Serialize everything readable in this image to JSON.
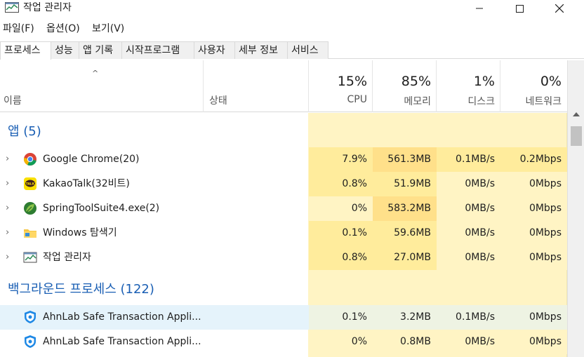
{
  "window": {
    "title": "작업 관리자",
    "minimize_glyph": "—",
    "maximize_glyph": "☐",
    "close_glyph": "✕"
  },
  "menu": [
    "파일(F)",
    "옵션(O)",
    "보기(V)"
  ],
  "tabs": [
    "프로세스",
    "성능",
    "앱 기록",
    "시작프로그램",
    "사용자",
    "세부 정보",
    "서비스"
  ],
  "active_tab": "프로세스",
  "header": {
    "sort_indicator": "^",
    "name": "이름",
    "status": "상태",
    "cpu": {
      "percent": "15%",
      "label": "CPU"
    },
    "memory": {
      "percent": "85%",
      "label": "메모리"
    },
    "disk": {
      "percent": "1%",
      "label": "디스크"
    },
    "network": {
      "percent": "0%",
      "label": "네트워크"
    }
  },
  "groups": {
    "apps": {
      "title": "앱 (5)",
      "rows": [
        {
          "name": "Google Chrome(20)",
          "icon": "chrome-icon",
          "cpu": "7.9%",
          "memory": "561.3MB",
          "disk": "0.1MB/s",
          "network": "0.2Mbps"
        },
        {
          "name": "KakaoTalk(32비트)",
          "icon": "kakaotalk-icon",
          "icon_text": "TALK",
          "cpu": "0.8%",
          "memory": "51.9MB",
          "disk": "0MB/s",
          "network": "0Mbps"
        },
        {
          "name": "SpringToolSuite4.exe(2)",
          "icon": "spring-icon",
          "cpu": "0%",
          "memory": "583.2MB",
          "disk": "0MB/s",
          "network": "0Mbps"
        },
        {
          "name": "Windows 탐색기",
          "icon": "folder-icon",
          "cpu": "0.1%",
          "memory": "59.6MB",
          "disk": "0MB/s",
          "network": "0Mbps"
        },
        {
          "name": "작업 관리자",
          "icon": "task-manager-icon",
          "cpu": "0.8%",
          "memory": "27.0MB",
          "disk": "0MB/s",
          "network": "0Mbps"
        }
      ]
    },
    "background": {
      "title": "백그라운드 프로세스 (122)",
      "rows": [
        {
          "name": "AhnLab Safe Transaction Appli...",
          "icon": "ahnlab-shield-icon",
          "cpu": "0.1%",
          "memory": "3.2MB",
          "disk": "0.1MB/s",
          "network": "0Mbps"
        },
        {
          "name": "AhnLab Safe Transaction Appli...",
          "icon": "ahnlab-shield-icon",
          "cpu": "0%",
          "memory": "0.8MB",
          "disk": "0MB/s",
          "network": "0Mbps"
        }
      ]
    }
  },
  "expander_glyph": "›",
  "colors": {
    "group_title": "#1a5fb4",
    "heat_low": "#fff4c4",
    "heat_mid": "#ffec9c",
    "heat_high": "#ffe08a",
    "selection": "#e5f3fb"
  }
}
